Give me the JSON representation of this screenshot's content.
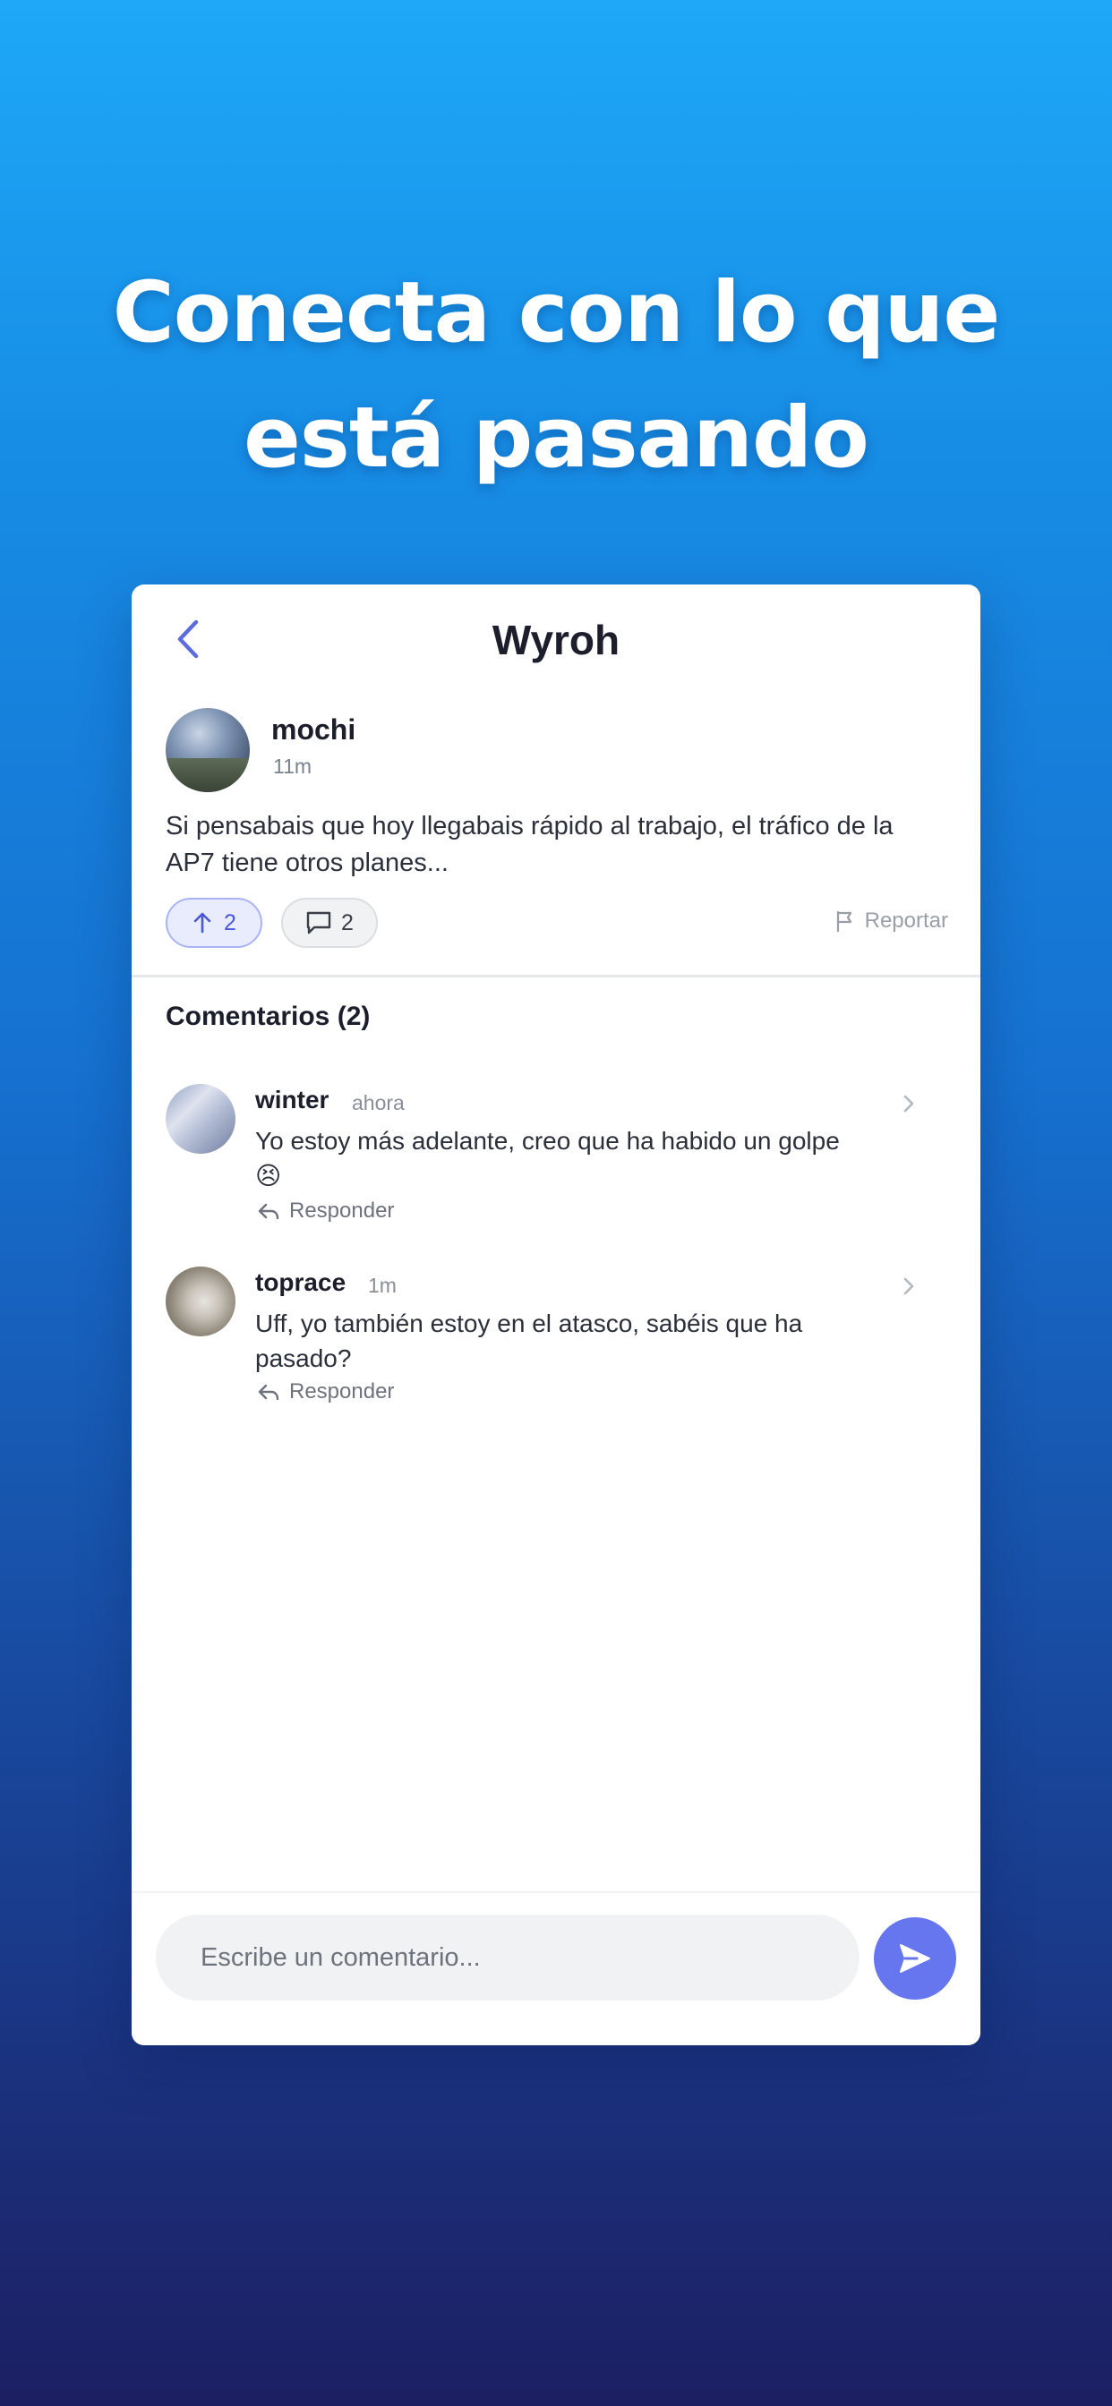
{
  "headline": {
    "line1": "Conecta con lo que",
    "line2": "está pasando"
  },
  "header": {
    "title": "Wyroh",
    "back_icon": "chevron-left-icon"
  },
  "post": {
    "author": "mochi",
    "time": "11m",
    "text": "Si pensabais que hoy llegabais rápido al trabajo, el tráfico de la AP7 tiene otros planes...",
    "upvotes": "2",
    "comment_count": "2",
    "report_label": "Reportar"
  },
  "comments_section": {
    "heading": "Comentarios (2)",
    "items": [
      {
        "author": "winter",
        "time": "ahora",
        "text": "Yo estoy más adelante, creo que ha habido un golpe 😣",
        "reply_label": "Responder"
      },
      {
        "author": "toprace",
        "time": "1m",
        "text": "Uff, yo también estoy en el atasco, sabéis que ha pasado?",
        "reply_label": "Responder"
      }
    ]
  },
  "composer": {
    "placeholder": "Escribe un comentario..."
  },
  "colors": {
    "accent": "#6676ee",
    "upvote_bg": "#e9ecfd",
    "gradient_top": "#1ea8f7",
    "gradient_bottom": "#1c1f62"
  }
}
